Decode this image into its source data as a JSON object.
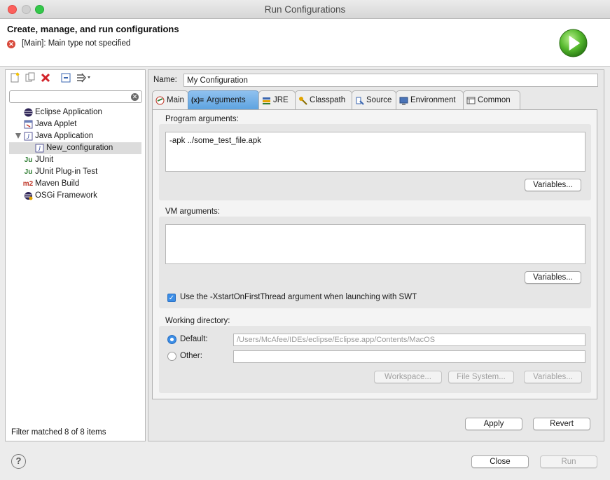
{
  "window": {
    "title": "Run Configurations"
  },
  "banner": {
    "title": "Create, manage, and run configurations",
    "message": "[Main]: Main type not specified"
  },
  "left": {
    "filter": {
      "value": "",
      "placeholder": ""
    },
    "tree": [
      {
        "label": "Eclipse Application",
        "icon": "eclipse-app-icon"
      },
      {
        "label": "Java Applet",
        "icon": "java-applet-icon"
      },
      {
        "label": "Java Application",
        "icon": "java-app-icon",
        "expanded": true
      },
      {
        "label": "New_configuration",
        "icon": "java-app-icon",
        "selected": true
      },
      {
        "label": "JUnit",
        "icon": "junit-icon"
      },
      {
        "label": "JUnit Plug-in Test",
        "icon": "junit-plugin-icon"
      },
      {
        "label": "Maven Build",
        "icon": "maven-icon"
      },
      {
        "label": "OSGi Framework",
        "icon": "osgi-icon"
      }
    ],
    "status": "Filter matched 8 of 8 items"
  },
  "right": {
    "name_label": "Name:",
    "name_value": "My Configuration",
    "tabs": [
      {
        "label": "Main",
        "icon": "main-tab-icon"
      },
      {
        "label": "Arguments",
        "icon": "arguments-tab-icon",
        "active": true
      },
      {
        "label": "JRE",
        "icon": "jre-tab-icon"
      },
      {
        "label": "Classpath",
        "icon": "classpath-tab-icon"
      },
      {
        "label": "Source",
        "icon": "source-tab-icon"
      },
      {
        "label": "Environment",
        "icon": "environment-tab-icon"
      },
      {
        "label": "Common",
        "icon": "common-tab-icon"
      }
    ],
    "program_args": {
      "label": "Program arguments:",
      "value": "-apk ../some_test_file.apk",
      "variables_btn": "Variables..."
    },
    "vm_args": {
      "label": "VM arguments:",
      "value": "",
      "variables_btn": "Variables...",
      "swt_checkbox_label": "Use the -XstartOnFirstThread argument when launching with SWT",
      "swt_checked": true
    },
    "working_dir": {
      "label": "Working directory:",
      "default_label": "Default:",
      "default_value": "/Users/McAfee/IDEs/eclipse/Eclipse.app/Contents/MacOS",
      "other_label": "Other:",
      "other_value": "",
      "workspace_btn": "Workspace...",
      "filesystem_btn": "File System...",
      "variables_btn": "Variables..."
    },
    "apply_btn": "Apply",
    "revert_btn": "Revert"
  },
  "footer": {
    "help": "?",
    "close_btn": "Close",
    "run_btn": "Run"
  }
}
